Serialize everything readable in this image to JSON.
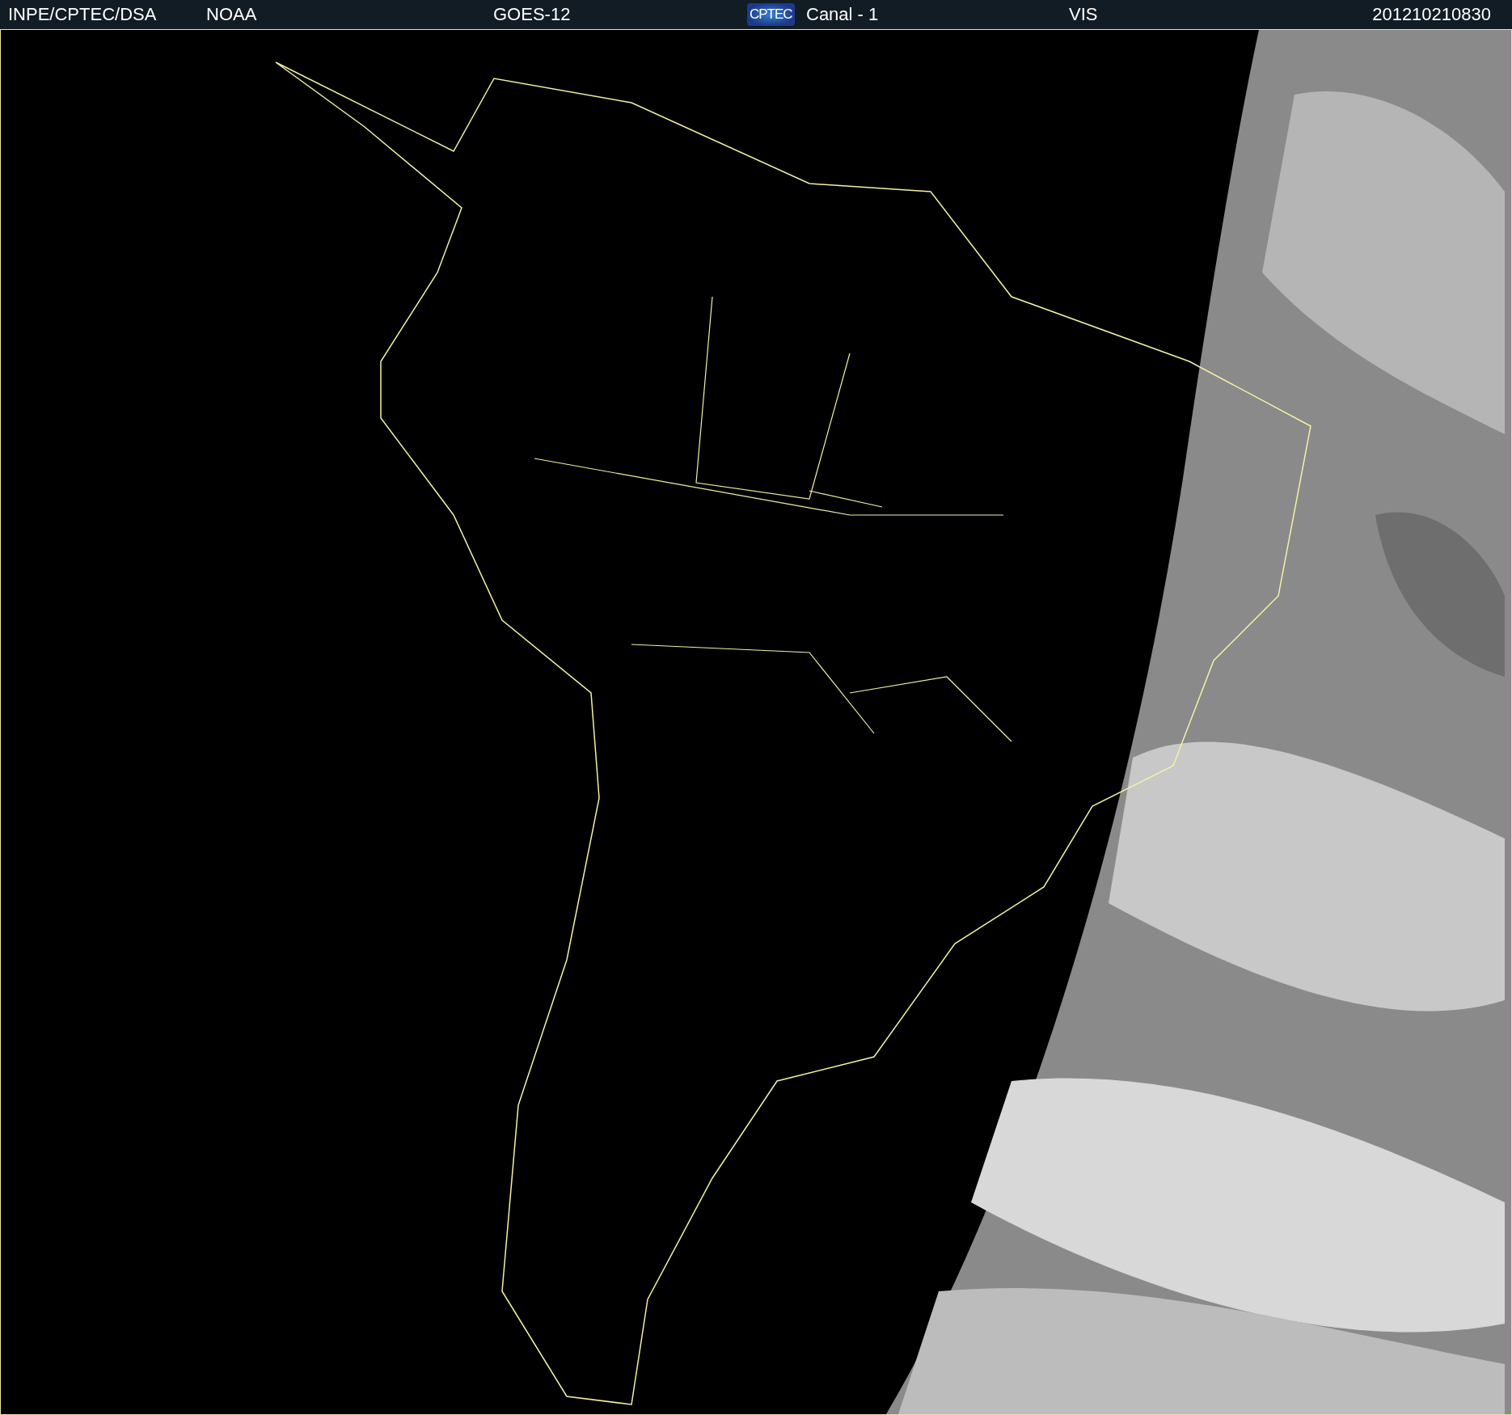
{
  "header": {
    "agency": "INPE/CPTEC/DSA",
    "provider": "NOAA",
    "satellite": "GOES-12",
    "logo": "CPTEC",
    "channel": "Canal - 1",
    "band": "VIS",
    "timestamp": "201210210830"
  }
}
